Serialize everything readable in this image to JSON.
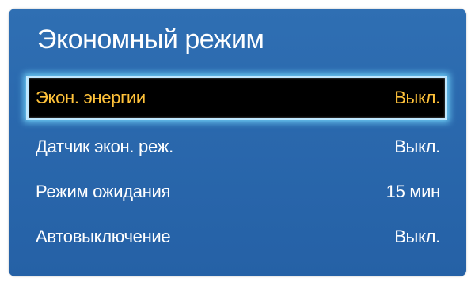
{
  "menu": {
    "title": "Экономный режим",
    "items": [
      {
        "label": "Экон. энергии",
        "value": "Выкл.",
        "selected": true
      },
      {
        "label": "Датчик экон. реж.",
        "value": "Выкл.",
        "selected": false
      },
      {
        "label": "Режим ожидания",
        "value": "15 мин",
        "selected": false
      },
      {
        "label": "Автовыключение",
        "value": "Выкл.",
        "selected": false
      }
    ]
  },
  "colors": {
    "panel_background": "#2a68ad",
    "selected_background": "#000000",
    "selected_text": "#ffc23a",
    "selection_glow": "#bfe7ff",
    "text": "#ffffff"
  }
}
